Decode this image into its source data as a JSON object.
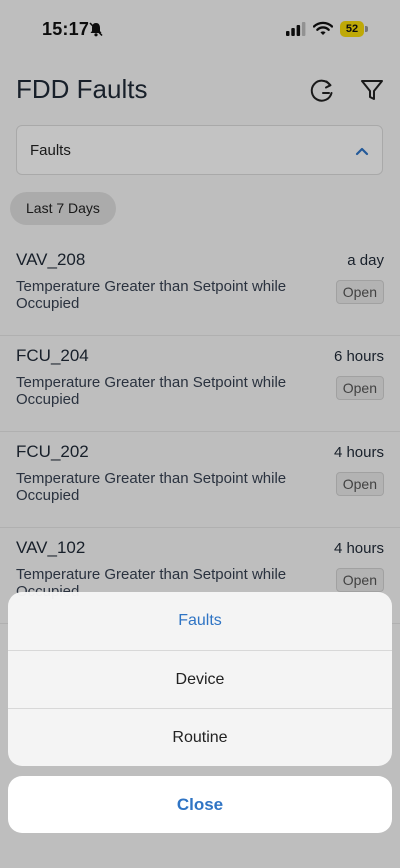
{
  "status_bar": {
    "time": "15:17",
    "battery": "52",
    "icons": [
      "bell-slash-icon",
      "signal-icon",
      "wifi-icon",
      "battery-icon"
    ]
  },
  "header": {
    "title": "FDD Faults",
    "icons": [
      "refresh-icon",
      "filter-icon"
    ]
  },
  "dropdown": {
    "selected": "Faults",
    "icon": "chevron-up-icon"
  },
  "filter_chip": {
    "label": "Last 7 Days"
  },
  "faults": [
    {
      "device": "VAV_208",
      "time": "a day",
      "description": "Temperature Greater than Setpoint while Occupied",
      "status": "Open"
    },
    {
      "device": "FCU_204",
      "time": "6 hours",
      "description": "Temperature Greater than Setpoint while Occupied",
      "status": "Open"
    },
    {
      "device": "FCU_202",
      "time": "4 hours",
      "description": "Temperature Greater than Setpoint while Occupied",
      "status": "Open"
    },
    {
      "device": "VAV_102",
      "time": "4 hours",
      "description": "Temperature Greater than Setpoint while Occupied",
      "status": "Open"
    }
  ],
  "action_sheet": {
    "options": [
      "Faults",
      "Device",
      "Routine"
    ],
    "selected": "Faults",
    "close_label": "Close"
  },
  "colors": {
    "accent": "#2f74c4",
    "battery": "#f5d90a",
    "page_bg": "#f4f4f4",
    "overlay": "rgba(0,0,0,0.22)"
  }
}
